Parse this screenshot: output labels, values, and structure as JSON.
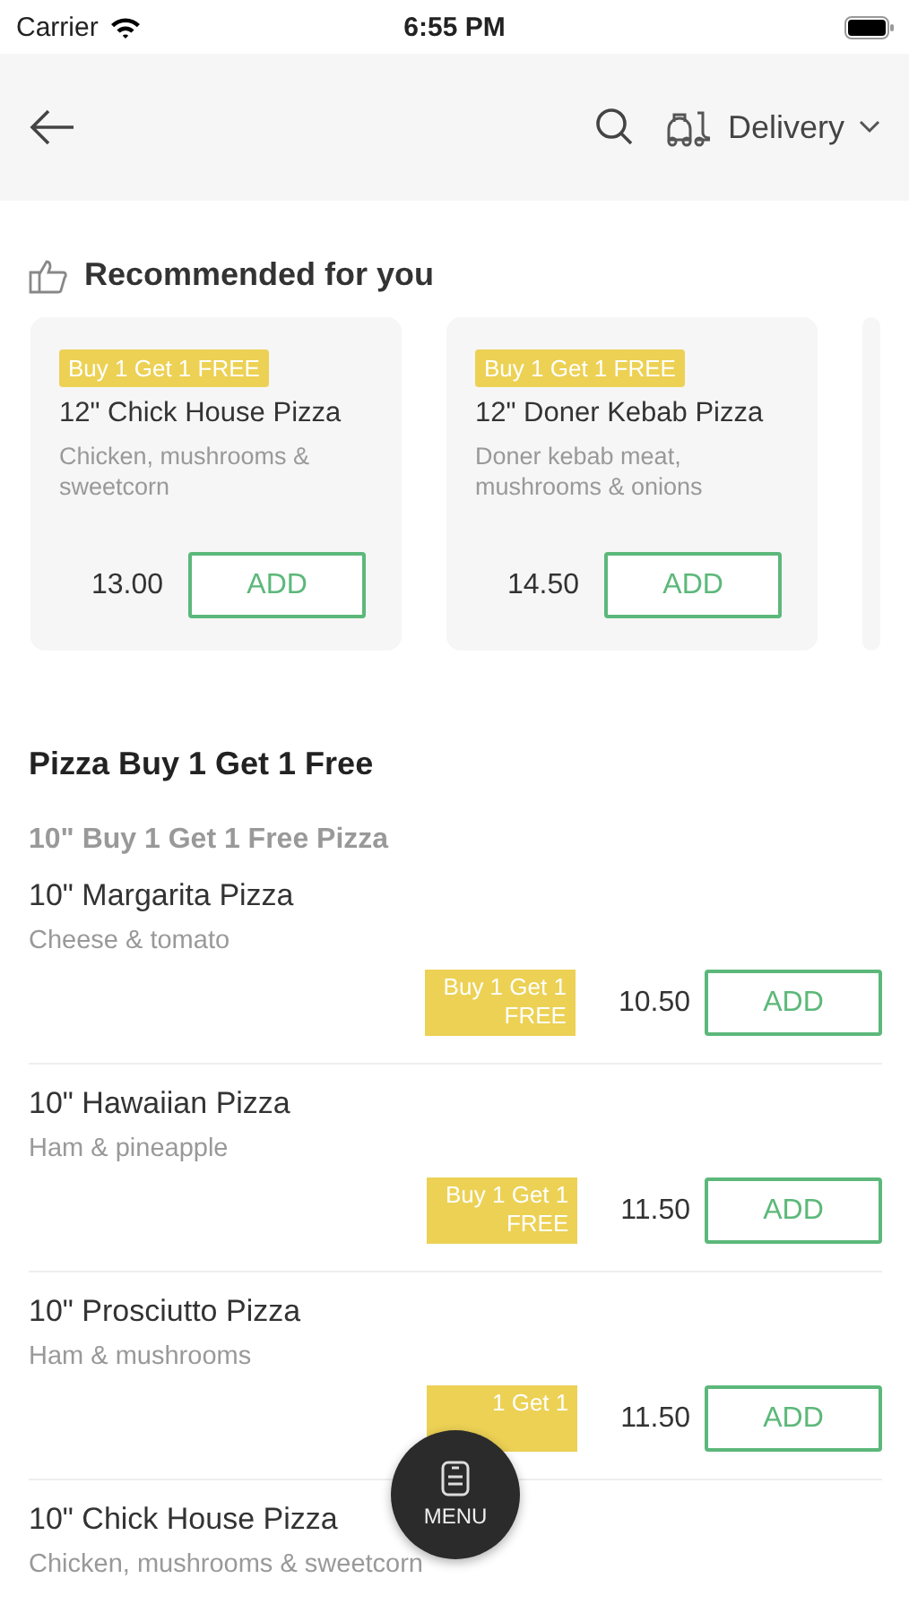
{
  "status_bar": {
    "carrier": "Carrier",
    "time": "6:55 PM"
  },
  "header": {
    "delivery_mode": "Delivery"
  },
  "recommended": {
    "title": "Recommended for you",
    "cards": [
      {
        "badge": "Buy 1 Get 1 FREE",
        "name": "12\" Chick House Pizza",
        "description": "Chicken, mushrooms & sweetcorn",
        "price": "13.00",
        "button": "ADD"
      },
      {
        "badge": "Buy 1 Get 1 FREE",
        "name": "12\" Doner Kebab Pizza",
        "description": "Doner kebab meat, mushrooms & onions",
        "price": "14.50",
        "button": "ADD"
      }
    ]
  },
  "section": {
    "title": "Pizza Buy 1 Get 1 Free",
    "subtitle": "10\" Buy 1 Get 1 Free Pizza",
    "items": [
      {
        "name": "10\" Margarita Pizza",
        "description": "Cheese & tomato",
        "badge": "Buy 1 Get 1 FREE",
        "price": "10.50",
        "button": "ADD"
      },
      {
        "name": "10\" Hawaiian Pizza",
        "description": "Ham & pineapple",
        "badge": "Buy 1 Get 1 FREE",
        "price": "11.50",
        "button": "ADD"
      },
      {
        "name": "10\" Prosciutto Pizza",
        "description": "Ham & mushrooms",
        "badge": "1 Get 1",
        "price": "11.50",
        "button": "ADD"
      },
      {
        "name": "10\" Chick House Pizza",
        "description": "Chicken, mushrooms & sweetcorn"
      }
    ]
  },
  "menu_button": {
    "label": "MENU"
  }
}
